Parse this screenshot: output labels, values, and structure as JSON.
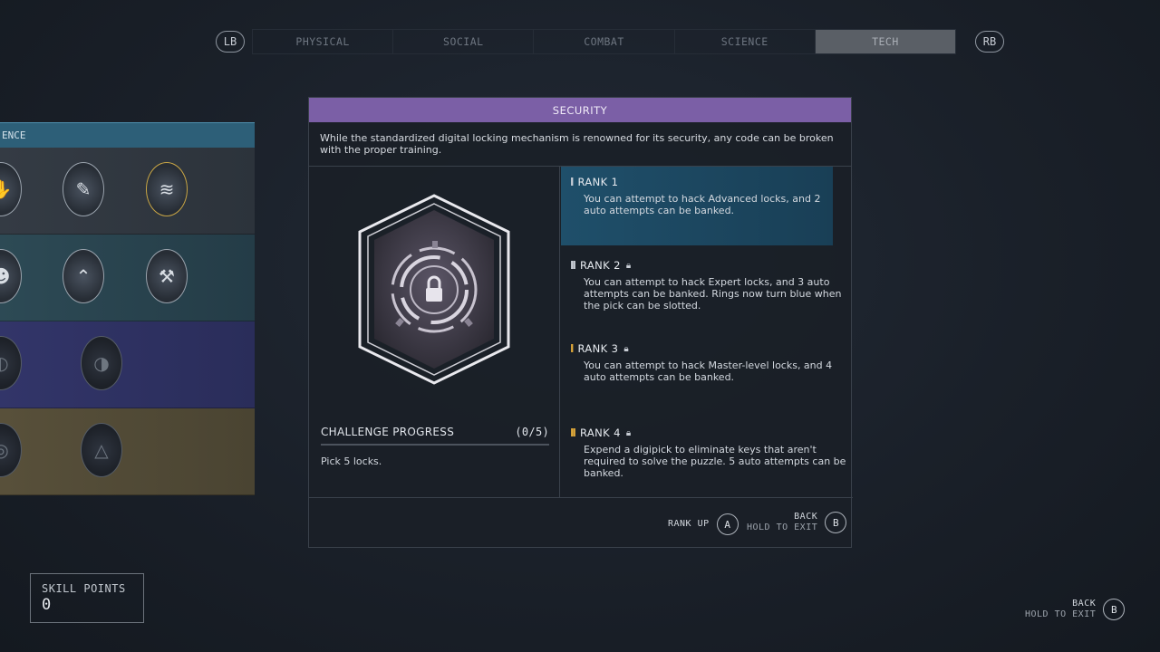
{
  "tabbar": {
    "lb": "LB",
    "rb": "RB",
    "tabs": [
      "PHYSICAL",
      "SOCIAL",
      "COMBAT",
      "SCIENCE",
      "TECH"
    ],
    "active_tab": "TECH"
  },
  "tree": {
    "header": "ENCE"
  },
  "panel": {
    "title": "SECURITY",
    "description": "While the standardized digital locking mechanism is renowned for its security, any code can be broken with the proper training.",
    "challenge": {
      "label": "CHALLENGE PROGRESS",
      "progress": "(0/5)",
      "text": "Pick 5 locks."
    },
    "ranks": [
      {
        "label": "RANK 1",
        "pips": "I",
        "locked": false,
        "selected": true,
        "text": "You can attempt to hack Advanced locks, and 2 auto attempts can be banked."
      },
      {
        "label": "RANK 2",
        "pips": "II",
        "locked": true,
        "selected": false,
        "text": "You can attempt to hack Expert locks, and 3 auto attempts can be banked. Rings now turn blue when the pick can be slotted."
      },
      {
        "label": "RANK 3",
        "pips": "I",
        "locked": true,
        "selected": false,
        "text": "You can attempt to hack Master-level locks, and 4 auto attempts can be banked."
      },
      {
        "label": "RANK 4",
        "pips": "II",
        "locked": true,
        "selected": false,
        "text": "Expend a digipick to eliminate keys that aren't required to solve the puzzle. 5 auto attempts can be banked."
      }
    ],
    "footer": {
      "rank_up_label": "RANK UP",
      "rank_up_button": "A",
      "back_label": "BACK",
      "back_sub": "HOLD TO EXIT",
      "back_button": "B"
    }
  },
  "skill_points": {
    "label": "SKILL POINTS",
    "value": "0"
  },
  "global_back": {
    "label": "BACK",
    "sub": "HOLD TO EXIT",
    "button": "B"
  },
  "colors": {
    "title_bar": "#7b5fa6",
    "selected_rank": "#1f4f6a",
    "rank_gold": "#e0a93a",
    "tree_header": "#2d5f78"
  }
}
